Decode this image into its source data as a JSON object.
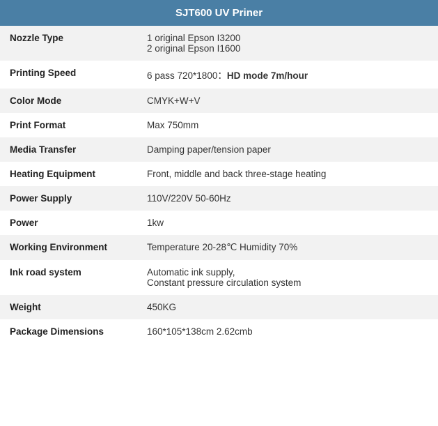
{
  "table": {
    "title": "SJT600 UV Priner",
    "rows": [
      {
        "label": "Nozzle Type",
        "value": "1 original Epson I3200\n2 original Epson I1600",
        "highlight": false
      },
      {
        "label": "Printing Speed",
        "value_plain": "6 pass 720*1800：",
        "value_bold": "HD mode 7m/hour",
        "highlight": true
      },
      {
        "label": "Color Mode",
        "value": "CMYK+W+V",
        "highlight": false
      },
      {
        "label": "Print Format",
        "value": "Max 750mm",
        "highlight": false
      },
      {
        "label": "Media Transfer",
        "value": "Damping paper/tension paper",
        "highlight": false
      },
      {
        "label": "Heating Equipment",
        "value": "Front, middle and back three-stage heating",
        "highlight": false
      },
      {
        "label": "Power Supply",
        "value": "110V/220V 50-60Hz",
        "highlight": false
      },
      {
        "label": "Power",
        "value": "1kw",
        "highlight": false
      },
      {
        "label": "Working Environment",
        "value": "Temperature 20-28℃ Humidity 70%",
        "highlight": false
      },
      {
        "label": "Ink road system",
        "value": "Automatic ink supply,\nConstant pressure circulation system",
        "highlight": false
      },
      {
        "label": "Weight",
        "value": "450KG",
        "highlight": false
      },
      {
        "label": "Package Dimensions",
        "value": "160*105*138cm 2.62cmb",
        "highlight": false
      }
    ]
  }
}
